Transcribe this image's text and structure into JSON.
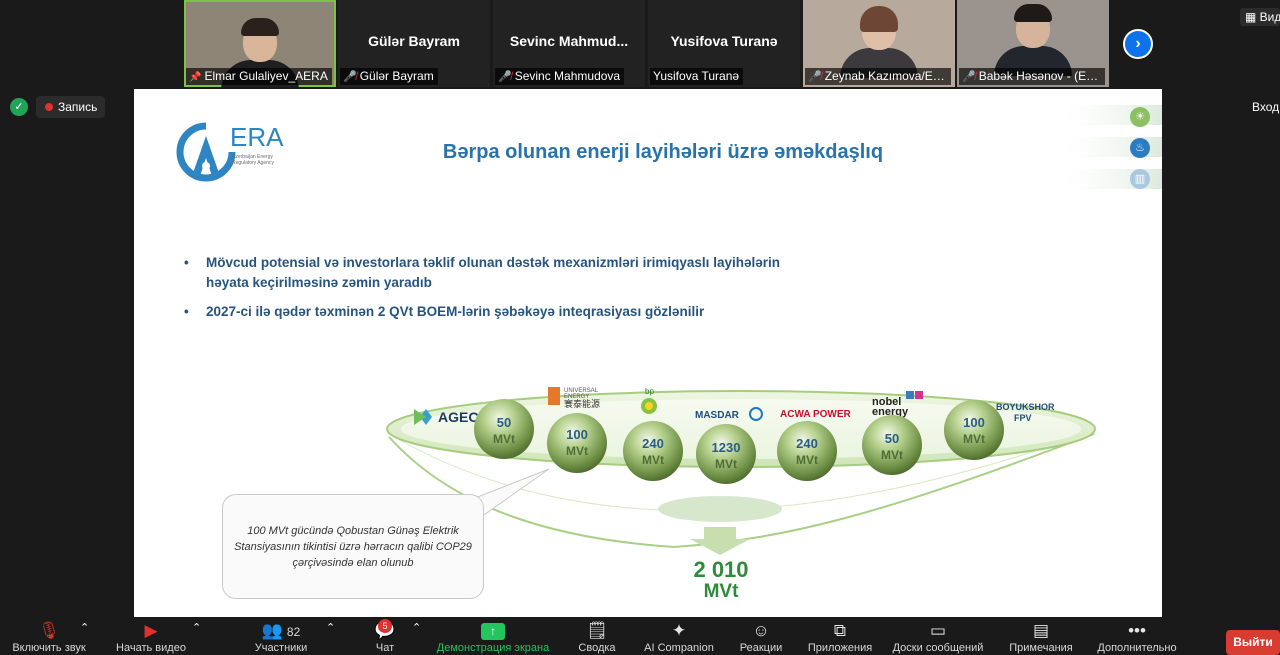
{
  "participants": [
    {
      "name": "Elmar Gulaliyev_AERA",
      "pinned": true,
      "muted": false,
      "video": true
    },
    {
      "name": "Gülər Bayram",
      "display": "Gülər Bayram",
      "muted": true,
      "video": false
    },
    {
      "name": "Sevinc Mahmudova",
      "display": "Sevinc  Mahmud...",
      "muted": true,
      "video": false
    },
    {
      "name": "Yusifova Turanə",
      "display": "Yusifova Turanə",
      "muted": false,
      "video": false
    },
    {
      "name": "Zeynab Kazımova/EM...",
      "muted": true,
      "video": true
    },
    {
      "name": "Babək Həsənov - (En...",
      "muted": true,
      "video": true
    }
  ],
  "top_right_label": "Вид",
  "recording_label": "Запись",
  "entry_label": "Вход",
  "slide": {
    "logo_word": "ERA",
    "logo_sub": "Azerbaijan Energy Regulatory Agency",
    "title": "Bərpa olunan enerji layihələri üzrə əməkdaşlıq",
    "bullets": [
      "Mövcud potensial və investorlara təklif olunan dəstək mexanizmləri irimiqyaslı layihələrin həyata keçirilməsinə zəmin yaradıb",
      "2027-ci ilə qədər təxminən 2 QVt BOEM-lərin şəbəkəyə inteqrasiyası gözlənilir"
    ],
    "projects": [
      {
        "company": "AGEC",
        "value": "50",
        "unit": "MVt"
      },
      {
        "company": "UNIVERSAL ENERGY 寰泰能源",
        "value": "100",
        "unit": "MVt"
      },
      {
        "company": "bp",
        "value": "240",
        "unit": "MVt"
      },
      {
        "company": "MASDAR",
        "value": "1230",
        "unit": "MVt"
      },
      {
        "company": "ACWA POWER",
        "value": "240",
        "unit": "MVt"
      },
      {
        "company": "nobel energy",
        "value": "50",
        "unit": "MVt"
      },
      {
        "company": "BOYUKSHOR FPV",
        "value": "100",
        "unit": "MVt"
      }
    ],
    "callout": "100 MVt gücündə Qobustan Günəş Elektrik Stansiyasının tikintisi üzrə hərracın qalibi COP29 çərçivəsində elan olunub",
    "total_value": "2 010",
    "total_unit": "MVt"
  },
  "toolbar": {
    "mic_label": "Включить звук",
    "video_label": "Начать видео",
    "participants_label": "Участники",
    "participants_count": "82",
    "chat_label": "Чат",
    "chat_badge": "5",
    "share_label": "Демонстрация экрана",
    "summary_label": "Сводка",
    "ai_label": "AI Companion",
    "reactions_label": "Реакции",
    "apps_label": "Приложения",
    "whiteboard_label": "Доски сообщений",
    "notes_label": "Примечания",
    "more_label": "Дополнительно",
    "leave_label": "Выйти"
  },
  "colors": {
    "accent_blue": "#0e72ed",
    "slide_title": "#2a73a8",
    "total_green": "#2f8a3c",
    "leave_red": "#d83b2f",
    "muted_red": "#e0312f"
  }
}
